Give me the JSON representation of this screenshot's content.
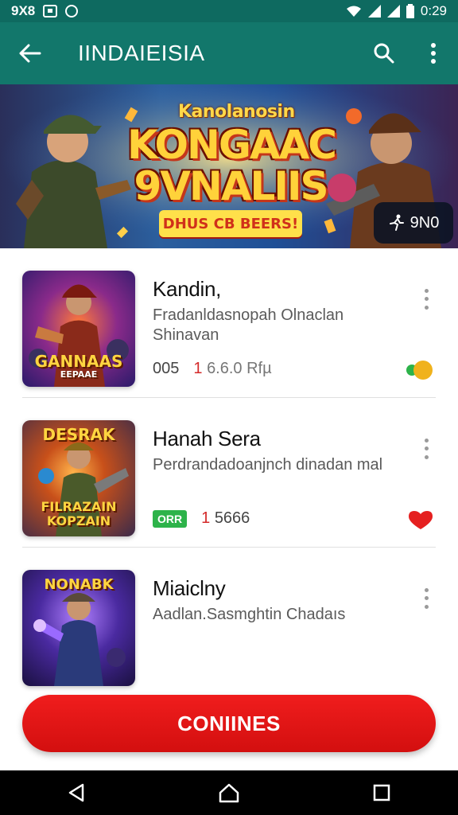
{
  "status_bar": {
    "left_text": "9X8",
    "time": "0:29",
    "icons": [
      "image-icon",
      "notification-icon",
      "wifi-icon",
      "signal-icon",
      "signal-icon",
      "battery-icon"
    ]
  },
  "app_bar": {
    "title": "IINDAIEISIA",
    "icons": [
      "back-arrow-icon",
      "search-icon",
      "overflow-menu-icon"
    ]
  },
  "banner": {
    "sub_text": "Kanolanosin",
    "title_line1": "KONGAAC",
    "title_line2": "9VNALIIS",
    "tagline": "DHUS CB BEERS!",
    "badge_text": "9N0",
    "badge_icon": "running-person-icon"
  },
  "items": [
    {
      "title": "Kandin,",
      "description": "Fradanldasnopah Olnaclan Shinavan",
      "thumb_label": "GANNAAS",
      "thumb_sub": "EEPAAE",
      "meta_count": "005",
      "meta_price_first": "1",
      "meta_price_rest": "6.6.0 Rfµ",
      "status_icon": "toggle-icon",
      "status_colors": [
        "#2db34a",
        "#f0b21c"
      ]
    },
    {
      "title": "Hanah Sera",
      "description": "Perdrandadoanjnch dinadan mal",
      "thumb_label": "DESRAK",
      "thumb_sub": "FILRAZAIN KOPZAIN",
      "meta_tag": "ORR",
      "meta_price_first": "1",
      "meta_price_rest": "5666",
      "status_icon": "heart-icon",
      "status_color": "#e52020"
    },
    {
      "title": "Miaiclny",
      "description": "Aadlan.Sasmghtin Chadaıs",
      "thumb_label": "NONABK"
    }
  ],
  "cta": {
    "label": "CONIINES"
  },
  "nav_bar": {
    "icons": [
      "back-triangle-icon",
      "home-icon",
      "recents-square-icon"
    ]
  },
  "colors": {
    "status_bar": "#0e6a60",
    "app_bar": "#12776b",
    "cta": "#e81717"
  }
}
